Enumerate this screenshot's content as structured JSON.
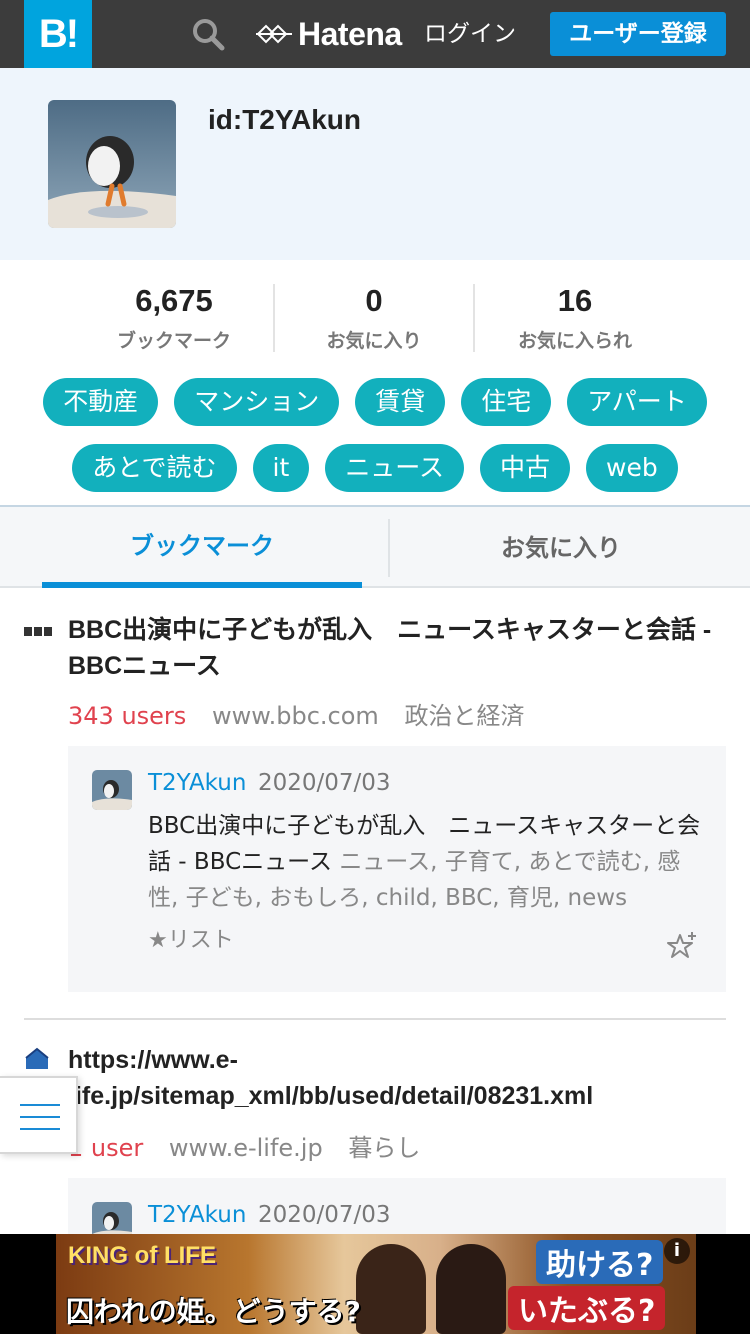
{
  "header": {
    "logo": "B!",
    "brand": "Hatena",
    "login": "ログイン",
    "signup": "ユーザー登録",
    "bg_color": "#3c3c3c",
    "logo_color": "#00a4de",
    "icons": [
      "search-icon",
      "hatena-mark-icon"
    ]
  },
  "profile": {
    "user_id": "id:T2YAkun"
  },
  "stats": [
    {
      "value": "6,675",
      "label": "ブックマーク"
    },
    {
      "value": "0",
      "label": "お気に入り"
    },
    {
      "value": "16",
      "label": "お気に入られ"
    }
  ],
  "tags": [
    [
      "不動産",
      "マンション",
      "賃貸",
      "住宅",
      "アパート"
    ],
    [
      "あとで読む",
      "it",
      "ニュース",
      "中古",
      "web"
    ]
  ],
  "tag_color": "#12b0bd",
  "tabs": {
    "bookmark": "ブックマーク",
    "favorites": "お気に入り",
    "active": "bookmark"
  },
  "entries": [
    {
      "favicon": "bbc-favicon-icon",
      "title": "BBC出演中に子どもが乱入　ニュースキャスターと会話 - BBCニュース",
      "users": "343 users",
      "domain": "www.bbc.com",
      "category": "政治と経済",
      "comment": {
        "user": "T2YAkun",
        "date": "2020/07/03",
        "text": "BBC出演中に子どもが乱入　ニュースキャスターと会話 - BBCニュース",
        "tags": "ニュース, 子育て, あとで読む, 感性, 子ども, おもしろ, child, BBC, 育児, news",
        "list": "★リスト"
      }
    },
    {
      "favicon": "house-favicon-icon",
      "title": "https://www.e-life.jp/sitemap_xml/bb/used/detail/08231.xml",
      "users": "1 user",
      "domain": "www.e-life.jp",
      "category": "暮らし",
      "comment": {
        "user": "T2YAkun",
        "date": "2020/07/03"
      }
    }
  ],
  "ad": {
    "title": "KING of LIFE",
    "text1": "囚われの姫。どうする?",
    "text2": "助ける?",
    "text3": "いたぶる?",
    "info": "i"
  }
}
